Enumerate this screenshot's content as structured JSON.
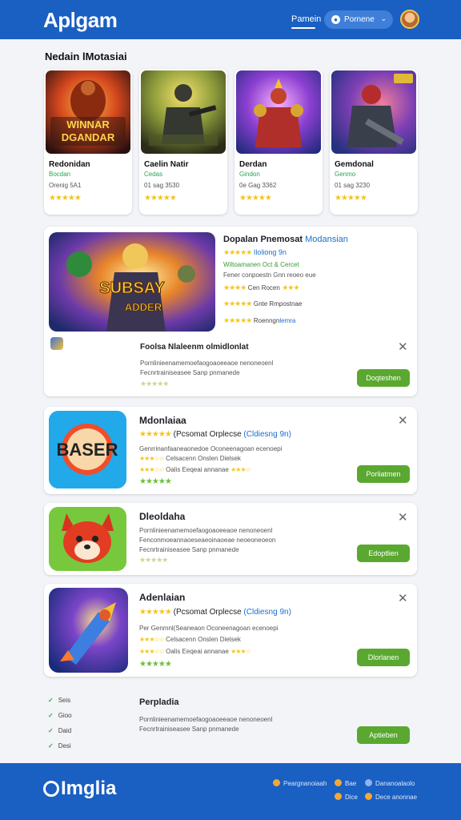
{
  "header": {
    "logo": "Aplgam",
    "nav_link": "Pamein",
    "pill_label": "Pornene",
    "pill_icon": "search-icon"
  },
  "section": {
    "title": "Nedain lMotasiai"
  },
  "top_cards": [
    {
      "art_text": "WINNAR DGANDAR",
      "title": "Redonidan",
      "sub": "Bocdan",
      "meta": "Orenig 5A1",
      "stars": "★★★★★"
    },
    {
      "art_text": "",
      "title": "Caelin Natir",
      "sub": "Cedas",
      "meta": "01 sag 3530",
      "stars": "★★★★★"
    },
    {
      "art_text": "",
      "title": "Derdan",
      "sub": "Gindon",
      "meta": "0e Gag 3362",
      "stars": "★★★★★"
    },
    {
      "art_text": "",
      "title": "Gemdonal",
      "sub": "Genmo",
      "meta": "01 sag 3230",
      "stars": "★★★★★"
    }
  ],
  "featured": {
    "art_text": "SUBSAY ADDER",
    "title": "Dopalan Pnemosat",
    "title_hl": "Modansian",
    "rating_stars": "★★★★★",
    "rating_text": "Iloliong 9n",
    "line_green": "Wiltoamanen Oct & Cercet",
    "line_grey": "Fener conpoestn Gnn reoeo eue",
    "row1_stars": "★★★★",
    "row1_text": "Cen Rocen",
    "row1_end_stars": "★★★",
    "row2_stars": "★★★★★",
    "row2_text": "Gnte Rmpostnae",
    "row3_stars": "★★★★★",
    "row3_text": "Roenngn",
    "row3_hl": "lemra",
    "sub_title": "Foolsa Nlaleenm olmidlonlat",
    "desc1": "Pornlinieenamemoefaogoaoeeaoe nenoneoenl",
    "desc2": "Fecnrtrainiseasee  Sanp pnmanede",
    "desc_stars": "★★★★★",
    "button": "Doqteshen"
  },
  "apps": [
    {
      "icon_text": "BASER",
      "title": "Mdonlaiaa",
      "stars": "★★★★★",
      "tag": "(Pcsomat Orplecse",
      "tag_hl": "(Cldiesng 9n)",
      "desc1": "Genrrinanfaaneaonedoe Oconeenagoan ecenoepi",
      "stars2": "★★★☆☆",
      "desc2": "Celsacenn Onslen Dielsek",
      "stars3": "★★★☆☆",
      "desc3": "Oalis Eeqeai annanae",
      "stars3b": "★★★☆",
      "stars_green": "★★★★★",
      "button": "Porliatmen"
    },
    {
      "icon_text": "",
      "title": "Dleoldaha",
      "stars": "",
      "tag": "",
      "tag_hl": "",
      "desc1": "Pornlinieenamemoefaogoaoeeaoe nenoneoenl",
      "stars2": "",
      "desc2": "Fenconmoeannaoeseaeoinaoeae neoeoneoeon",
      "stars3": "",
      "desc3": "Fecnrtrainiseasee  Sanp pnmanede",
      "stars3b": "",
      "stars_green": "★★★★★",
      "button": "Edoptlien"
    },
    {
      "icon_text": "",
      "title": "Adenlaian",
      "stars": "★★★★★",
      "tag": "(Pcsomat Orplecse",
      "tag_hl": "(Cldiesng 9n)",
      "desc1": "Per Genmnl(Seaneaon Oconeenagoan ecenoepi",
      "stars2": "★★★☆☆",
      "desc2": "Celsacenn Onslen Dielsek",
      "stars3": "★★★☆☆",
      "desc3": "Oalis Eeqeai annanae",
      "stars3b": "★★★☆",
      "stars_green": "★★★★★",
      "button": "Dlorlanen"
    }
  ],
  "last": {
    "side_items": [
      "Seis",
      "Gioo",
      "Daid",
      "Desi"
    ],
    "title": "Perpladia",
    "desc1": "Pornlinieenamemoefaogoaoeeaoe nenoneoenl",
    "desc2": "Fecnrtrainiseasee  Sanp pnmanede",
    "button": "Aptieben"
  },
  "footer": {
    "logo": "Imglia",
    "links": [
      "Peargnanoiaah",
      "Bae",
      "Dananoalaolo",
      "Dice",
      "Dece anonnae"
    ]
  },
  "colors": {
    "brand_blue": "#1a5fc2",
    "green": "#5aa82f",
    "star": "#f5c518"
  }
}
